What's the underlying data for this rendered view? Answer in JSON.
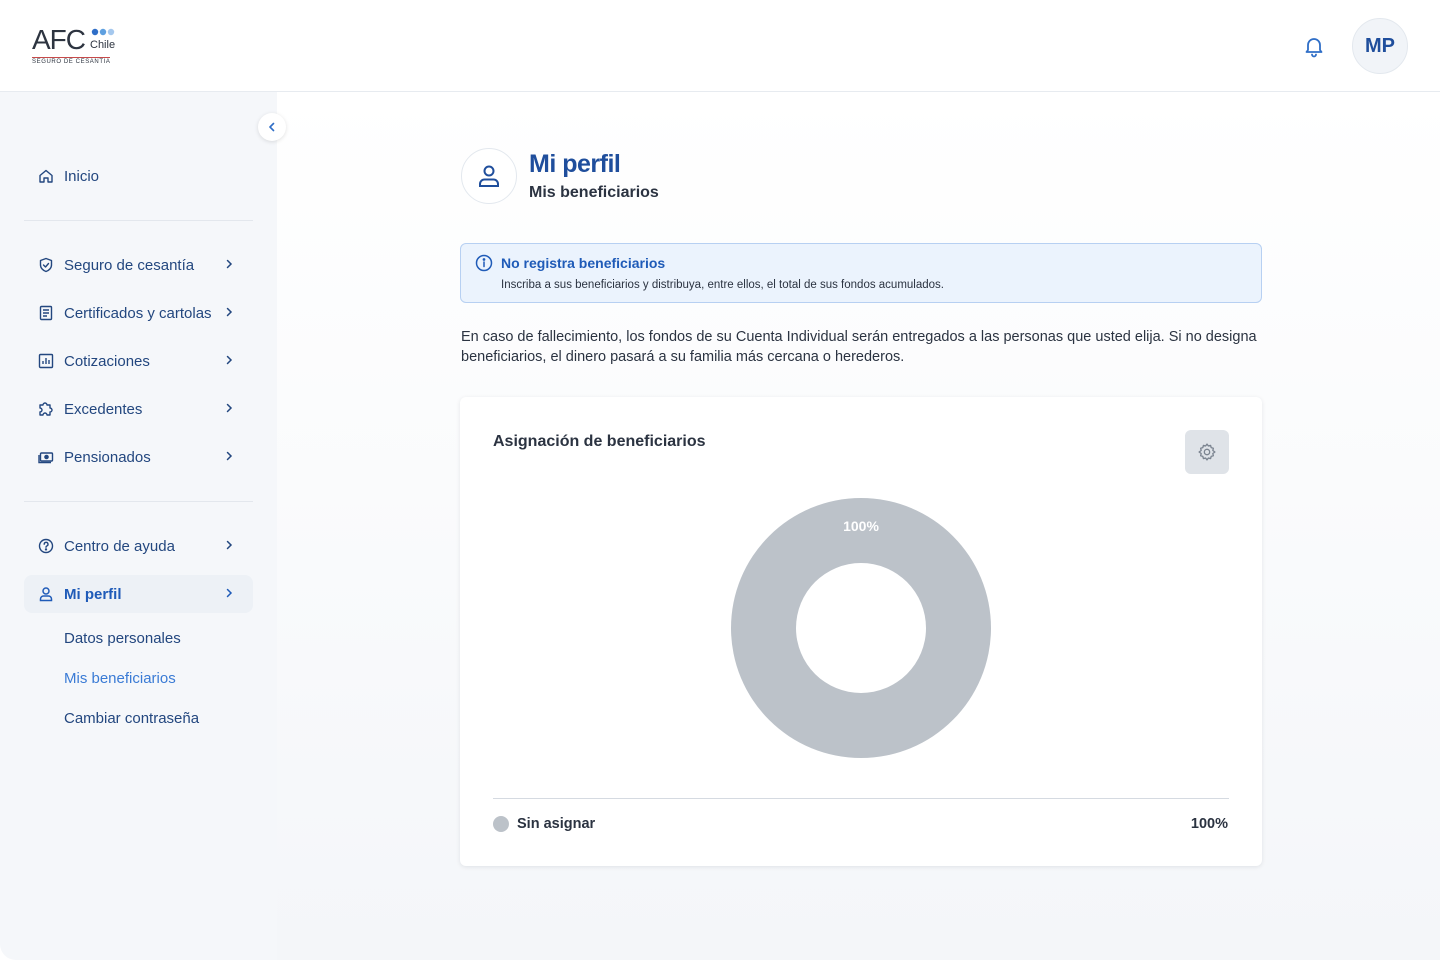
{
  "header": {
    "logo": {
      "brand": "AFC",
      "country": "Chile",
      "tagline": "SEGURO DE CESANTIA"
    },
    "avatar_initials": "MP"
  },
  "sidebar": {
    "items": [
      {
        "label": "Inicio",
        "icon": "home-icon"
      },
      {
        "label": "Seguro de cesantía",
        "icon": "shield-check-icon"
      },
      {
        "label": "Certificados y cartolas",
        "icon": "document-list-icon"
      },
      {
        "label": "Cotizaciones",
        "icon": "bar-chart-icon"
      },
      {
        "label": "Excedentes",
        "icon": "puzzle-icon"
      },
      {
        "label": "Pensionados",
        "icon": "cash-icon"
      },
      {
        "label": "Centro de  ayuda",
        "icon": "help-circle-icon"
      },
      {
        "label": "Mi perfil",
        "icon": "user-icon"
      }
    ],
    "sub_items": [
      {
        "label": "Datos personales"
      },
      {
        "label": "Mis beneficiarios"
      },
      {
        "label": "Cambiar contraseña"
      }
    ]
  },
  "main": {
    "title": "Mi perfil",
    "subtitle": "Mis beneficiarios",
    "alert": {
      "title": "No registra beneficiarios",
      "description": "Inscriba a sus beneficiarios y distribuya, entre ellos, el total de sus fondos acumulados."
    },
    "paragraph": "En caso de fallecimiento, los fondos de su Cuenta Individual serán entregados a las personas que usted elija. Si no designa beneficiarios, el dinero pasará a su familia más cercana o herederos.",
    "card": {
      "title": "Asignación de beneficiarios",
      "legend": [
        {
          "label": "Sin asignar",
          "value": "100%",
          "color": "#bcc2c9"
        }
      ]
    }
  },
  "chart_data": {
    "type": "pie",
    "categories": [
      "Sin asignar"
    ],
    "values": [
      100
    ],
    "data_labels": [
      "100%"
    ],
    "colors": [
      "#bcc2c9"
    ]
  }
}
